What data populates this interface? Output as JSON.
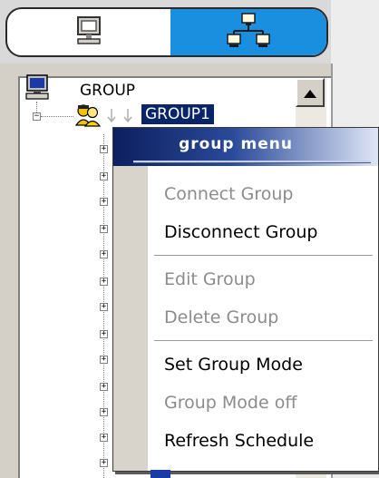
{
  "tabs": {
    "local": {
      "icon": "computer-icon"
    },
    "network": {
      "icon": "network-icon"
    }
  },
  "tree": {
    "root": {
      "label": "GROUP",
      "icon": "computer-icon"
    },
    "selected": {
      "label": "GROUP1",
      "icon": "group-users-icon"
    }
  },
  "context_menu": {
    "title": "group menu",
    "items": [
      {
        "label": "Connect Group",
        "enabled": false
      },
      {
        "label": "Disconnect Group",
        "enabled": true
      },
      {
        "label": "Edit Group",
        "enabled": false
      },
      {
        "label": "Delete Group",
        "enabled": false
      },
      {
        "label": "Set Group Mode",
        "enabled": true
      },
      {
        "label": "Group Mode off",
        "enabled": false
      },
      {
        "label": "Refresh Schedule",
        "enabled": true
      }
    ]
  },
  "colors": {
    "selected_tab": "#1a8fe0",
    "selection_highlight": "#0a246a",
    "menu_header_dark": "#0d1f5e"
  }
}
